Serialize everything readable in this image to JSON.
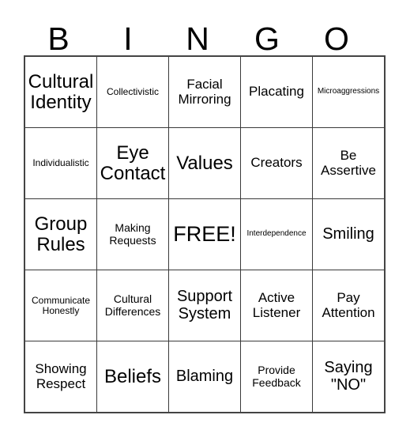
{
  "card": {
    "type": "bingo-card",
    "header_letters": [
      "B",
      "I",
      "N",
      "G",
      "O"
    ],
    "columns": 5,
    "rows": 5,
    "free_space_label": "FREE!",
    "free_space_position": {
      "row": 3,
      "column": 3
    },
    "colors": {
      "background": "#ffffff",
      "text": "#000000",
      "grid_line": "#3a3a3a"
    },
    "rows_data": [
      [
        {
          "label": "Cultural Identity",
          "size": "sz-xxl"
        },
        {
          "label": "Collectivistic",
          "size": "sz-sm"
        },
        {
          "label": "Facial Mirroring",
          "size": "sz-lg"
        },
        {
          "label": "Placating",
          "size": "sz-lg"
        },
        {
          "label": "Microaggressions",
          "size": "sz-xs"
        }
      ],
      [
        {
          "label": "Individualistic",
          "size": "sz-sm"
        },
        {
          "label": "Eye Contact",
          "size": "sz-xxl"
        },
        {
          "label": "Values",
          "size": "sz-xxl"
        },
        {
          "label": "Creators",
          "size": "sz-lg"
        },
        {
          "label": "Be Assertive",
          "size": "sz-lg"
        }
      ],
      [
        {
          "label": "Group Rules",
          "size": "sz-xxl"
        },
        {
          "label": "Making Requests",
          "size": "sz-md"
        },
        {
          "label": "FREE!",
          "size": "sz-free"
        },
        {
          "label": "Interdependence",
          "size": "sz-xs"
        },
        {
          "label": "Smiling",
          "size": "sz-xl"
        }
      ],
      [
        {
          "label": "Communicate Honestly",
          "size": "sz-sm"
        },
        {
          "label": "Cultural Differences",
          "size": "sz-md"
        },
        {
          "label": "Support System",
          "size": "sz-xl"
        },
        {
          "label": "Active Listener",
          "size": "sz-lg"
        },
        {
          "label": "Pay Attention",
          "size": "sz-lg"
        }
      ],
      [
        {
          "label": "Showing Respect",
          "size": "sz-lg"
        },
        {
          "label": "Beliefs",
          "size": "sz-xxl"
        },
        {
          "label": "Blaming",
          "size": "sz-xl"
        },
        {
          "label": "Provide Feedback",
          "size": "sz-md"
        },
        {
          "label": "Saying \"NO\"",
          "size": "sz-xl"
        }
      ]
    ]
  }
}
